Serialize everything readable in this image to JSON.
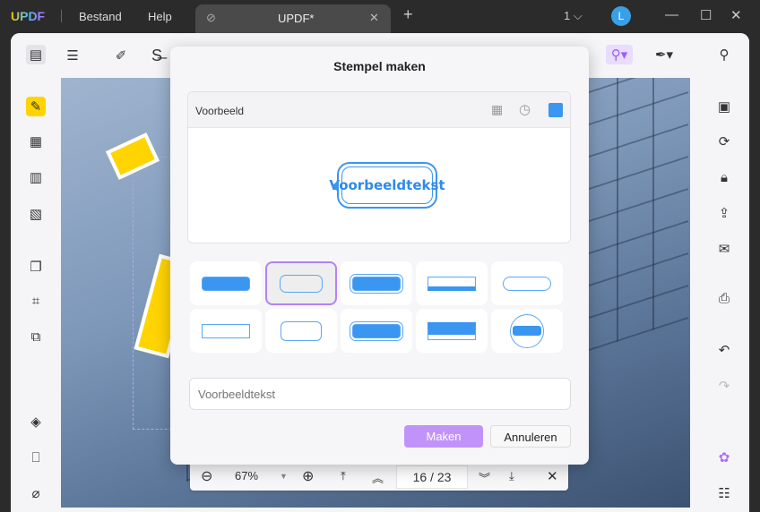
{
  "app": {
    "logo": "UPDF",
    "menu": [
      "Bestand",
      "Help"
    ],
    "tab_title": "UPDF*",
    "page_indicator": "1",
    "avatar": "L"
  },
  "dialog": {
    "title": "Stempel maken",
    "preview_label": "Voorbeeld",
    "preview_text": "Voorbeeldtekst",
    "input_placeholder": "Voorbeeldtekst",
    "create": "Maken",
    "cancel": "Annuleren",
    "selected_style": 2,
    "accent": "#3a96f0"
  },
  "zoombar": {
    "zoom": "67%",
    "page": "16 / 23"
  }
}
